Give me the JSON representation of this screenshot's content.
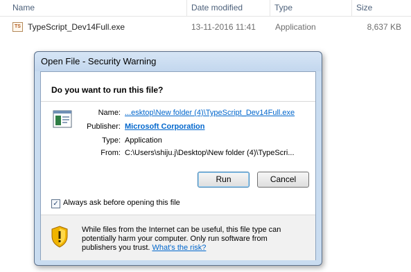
{
  "explorer": {
    "columns": {
      "name": "Name",
      "date": "Date modified",
      "type": "Type",
      "size": "Size"
    },
    "file": {
      "name": "TypeScript_Dev14Full.exe",
      "date": "13-11-2016 11:41",
      "type": "Application",
      "size": "8,637 KB",
      "icon": "typescript-file-icon",
      "icon_text": "TS"
    }
  },
  "dialog": {
    "title": "Open File - Security Warning",
    "question": "Do you want to run this file?",
    "fields": {
      "name_label": "Name:",
      "name_value": "...esktop\\New folder (4)\\TypeScript_Dev14Full.exe",
      "publisher_label": "Publisher:",
      "publisher_value": "Microsoft Corporation",
      "type_label": "Type:",
      "type_value": "Application",
      "from_label": "From:",
      "from_value": "C:\\Users\\shiju.j\\Desktop\\New folder (4)\\TypeScri..."
    },
    "buttons": {
      "run": "Run",
      "cancel": "Cancel"
    },
    "checkbox": {
      "label": "Always ask before opening this file",
      "checked": true
    },
    "warning": {
      "text": "While files from the Internet can be useful, this file type can potentially harm your computer. Only run software from publishers you trust.",
      "link": "What's the risk?"
    },
    "colors": {
      "link": "#0066cc",
      "frame": "#c9dcf0",
      "shield": "#f0b400"
    }
  }
}
